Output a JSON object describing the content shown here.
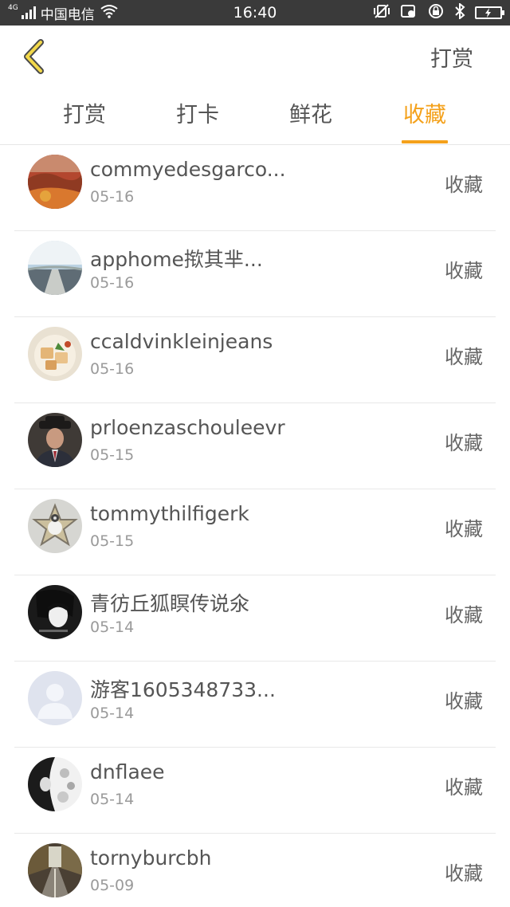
{
  "status_bar": {
    "network": "4G",
    "carrier": "中国电信",
    "time": "16:40",
    "battery_icon": "battery-charging-icon"
  },
  "header": {
    "back_icon": "chevron-left-icon",
    "action_label": "打赏"
  },
  "tabs": [
    {
      "label": "打赏",
      "active": false
    },
    {
      "label": "打卡",
      "active": false
    },
    {
      "label": "鲜花",
      "active": false
    },
    {
      "label": "收藏",
      "active": true
    }
  ],
  "colors": {
    "accent": "#f4a11b",
    "statusbar": "#3a3a3a",
    "text": "#555555",
    "muted": "#9a9a9a"
  },
  "list": [
    {
      "name": "commyedesgarco...",
      "date": "05-16",
      "action": "收藏",
      "avatar": "autumn-landscape"
    },
    {
      "name": "apphome揿其芈...",
      "date": "05-16",
      "action": "收藏",
      "avatar": "road-sky"
    },
    {
      "name": "ccaldvinkleinjeans",
      "date": "05-16",
      "action": "收藏",
      "avatar": "food-dish"
    },
    {
      "name": "prloenzaschouleevr",
      "date": "05-15",
      "action": "收藏",
      "avatar": "man-in-hat"
    },
    {
      "name": "tommythilfigerk",
      "date": "05-15",
      "action": "收藏",
      "avatar": "star-sheep"
    },
    {
      "name": "青彷丘狐瞑传说氽",
      "date": "05-14",
      "action": "收藏",
      "avatar": "bw-portrait"
    },
    {
      "name": "游客1605348733...",
      "date": "05-14",
      "action": "收藏",
      "avatar": "default-user"
    },
    {
      "name": "dnflaee",
      "date": "05-14",
      "action": "收藏",
      "avatar": "bw-flowers"
    },
    {
      "name": "tornyburcbh",
      "date": "05-09",
      "action": "收藏",
      "avatar": "forest-road"
    }
  ]
}
